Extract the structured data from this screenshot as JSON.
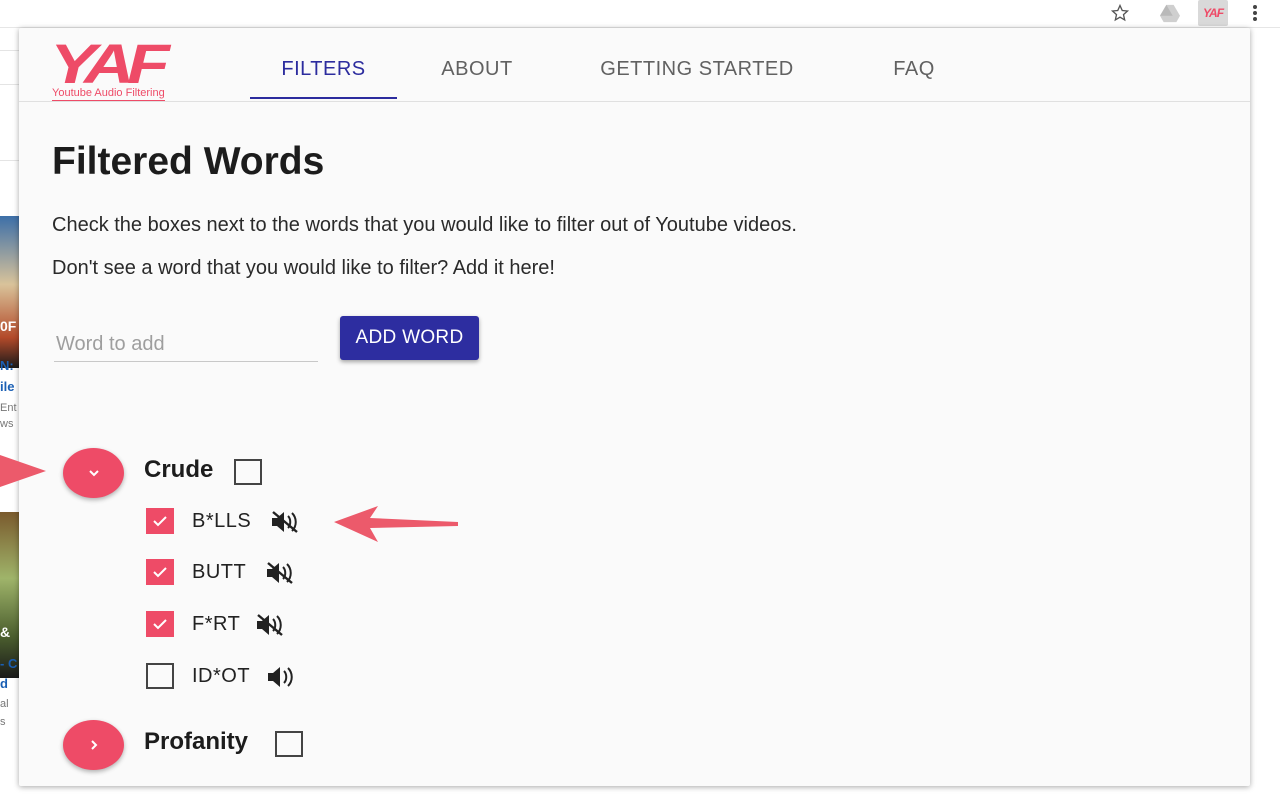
{
  "app": {
    "logo_text": "YAF",
    "logo_subtitle": "Youtube Audio Filtering"
  },
  "nav": {
    "tabs": [
      {
        "label": "FILTERS",
        "active": true
      },
      {
        "label": "ABOUT",
        "active": false
      },
      {
        "label": "GETTING STARTED",
        "active": false
      },
      {
        "label": "FAQ",
        "active": false
      }
    ]
  },
  "main": {
    "title": "Filtered Words",
    "description": "Check the boxes next to the words that you would like to filter out of Youtube videos.",
    "prompt": "Don't see a word that you would like to filter? Add it here!",
    "word_input_placeholder": "Word to add",
    "add_button_label": "ADD WORD"
  },
  "categories": [
    {
      "name": "Crude",
      "expanded": true,
      "checked": false,
      "words": [
        {
          "word": "B*LLS",
          "checked": true,
          "muted": true
        },
        {
          "word": "BUTT",
          "checked": true,
          "muted": true
        },
        {
          "word": "F*RT",
          "checked": true,
          "muted": true
        },
        {
          "word": "ID*OT",
          "checked": false,
          "muted": false
        }
      ]
    },
    {
      "name": "Profanity",
      "expanded": false,
      "checked": false,
      "words": []
    }
  ],
  "browser": {
    "extension_badge": "YAF"
  },
  "background_page": {
    "snippets": [
      "0F",
      "N:",
      "ile",
      "Ent",
      "ws",
      "&",
      "- C",
      "d",
      "al",
      "s"
    ]
  },
  "colors": {
    "brand": "#ee4b67",
    "primary": "#2d2da0",
    "annotation_arrow": "#ec5a6b"
  }
}
